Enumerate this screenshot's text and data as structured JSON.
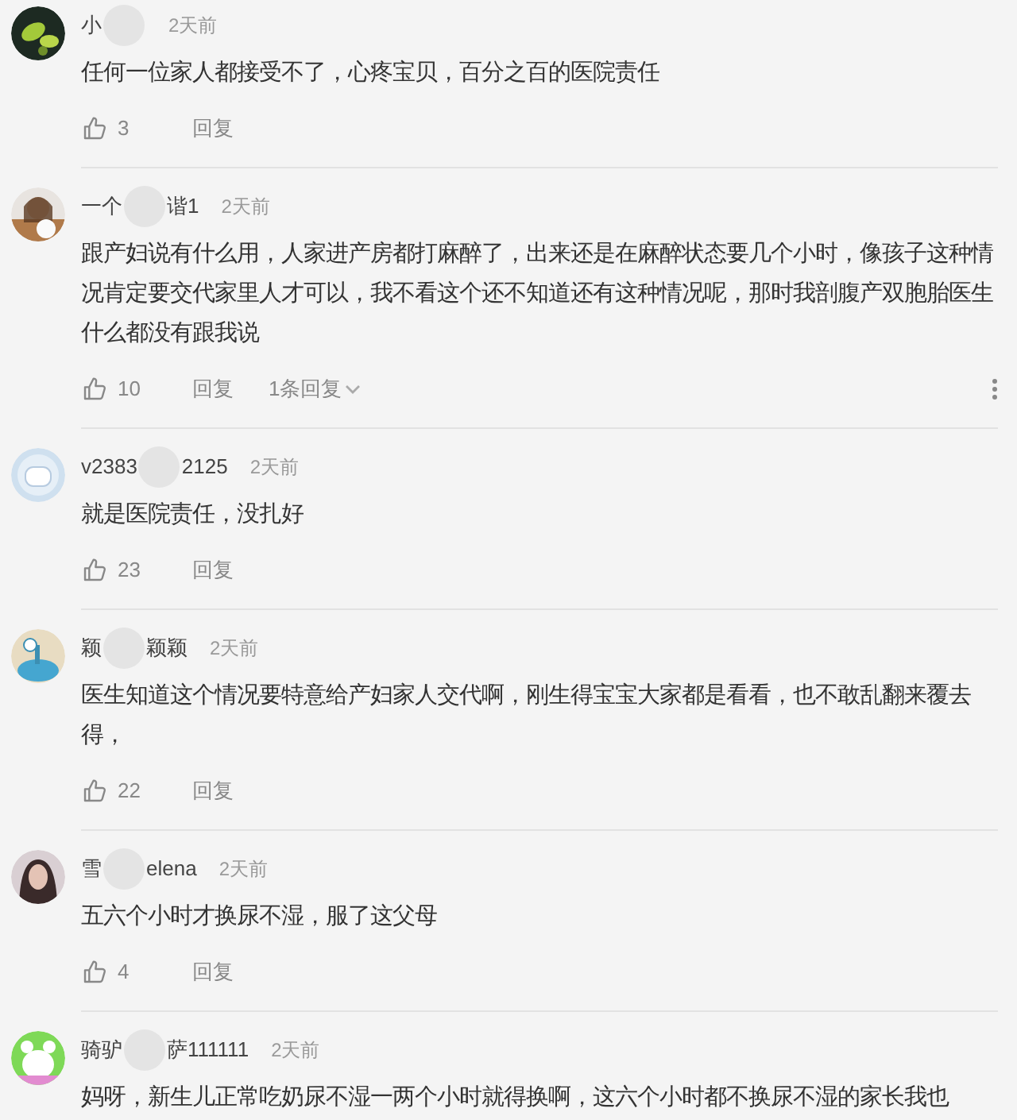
{
  "comments": [
    {
      "name_parts": [
        "小"
      ],
      "time": "2天前",
      "text": "任何一位家人都接受不了，心疼宝贝，百分之百的医院责任",
      "likes": "3",
      "reply": "回复",
      "avatar": {
        "kind": "picture"
      }
    },
    {
      "name_parts": [
        "一个",
        "谐1"
      ],
      "time": "2天前",
      "text": "跟产妇说有什么用，人家进产房都打麻醉了，出来还是在麻醉状态要几个小时，像孩子这种情况肯定要交代家里人才可以，我不看这个还不知道还有这种情况呢，那时我剖腹产双胞胎医生什么都没有跟我说",
      "likes": "10",
      "reply": "回复",
      "replies": "1条回复",
      "avatar": {
        "kind": "picture"
      }
    },
    {
      "name_parts": [
        "v2383",
        "2125"
      ],
      "time": "2天前",
      "text": "就是医院责任，没扎好",
      "likes": "23",
      "reply": "回复",
      "avatar": {
        "kind": "picture"
      }
    },
    {
      "name_parts": [
        "颖",
        "颖颖"
      ],
      "time": "2天前",
      "text": "医生知道这个情况要特意给产妇家人交代啊，刚生得宝宝大家都是看看，也不敢乱翻来覆去得，",
      "likes": "22",
      "reply": "回复",
      "avatar": {
        "kind": "picture"
      }
    },
    {
      "name_parts": [
        "雪",
        "elena"
      ],
      "time": "2天前",
      "text": "五六个小时才换尿不湿，服了这父母",
      "likes": "4",
      "reply": "回复",
      "avatar": {
        "kind": "picture"
      }
    },
    {
      "name_parts": [
        "骑驴",
        "萨111111"
      ],
      "time": "2天前",
      "text": "妈呀，新生儿正常吃奶尿不湿一两个小时就得换啊，这六个小时都不换尿不湿的家长我也",
      "avatar": {
        "kind": "picture"
      }
    }
  ]
}
